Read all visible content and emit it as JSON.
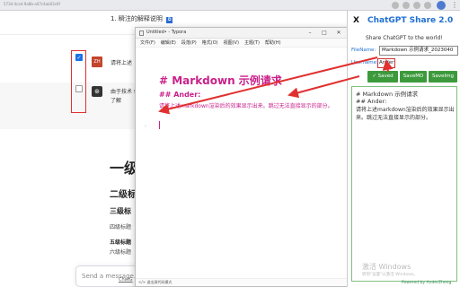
{
  "browser": {
    "url_text": "5734-4ca4-9a8b-a07c4ab03c6f"
  },
  "chat": {
    "numbered_item": "1. 瞬注的解释说明",
    "copy_icon": "copy-icon",
    "user_avatar": "ZH",
    "user_message": "请将上述",
    "gpt_avatar": "⊛",
    "gpt_message": "由于技术 便宜了解",
    "h1": "一级",
    "h2": "二级标",
    "h3": "三级标",
    "h4": "四级标题",
    "h5": "五级标题",
    "h6": "六级标题",
    "send_placeholder": "Send a message...",
    "footer_link": "ChatG"
  },
  "typora": {
    "title": "Untitled• - Typora",
    "menu": [
      "文件(F)",
      "编辑(E)",
      "段落(P)",
      "格式(O)",
      "视图(V)",
      "主题(T)",
      "帮助(H)"
    ],
    "heading1": "# Markdown 示例请求",
    "heading2": "## Ander:",
    "paragraph": "请将上述markdown渲染后的效果显示出来。跳过无法直接显示的部分。",
    "status": "</> 退出源代码模式",
    "colors": {
      "source_text": "#c9218a"
    }
  },
  "extension": {
    "close_label": "X",
    "title": "ChatGPT Share 2.0",
    "subtitle": "Share ChatGPT to the world!",
    "filename_label": "FileName:",
    "filename_value": "Markdown 示例请求_2023040",
    "username_label": "Username:",
    "username_value": "Ander",
    "buttons": {
      "saved": "✓ Saved",
      "savemd": "SaveMD",
      "saveimg": "SaveImg"
    },
    "preview_h1": "# Markdown 示例请求",
    "preview_h2": "## Ander:",
    "preview_paragraph": "请将上述markdown渲染后的效果显示出来。跳过无法直接显示的部分。",
    "activate_title": "激活 Windows",
    "activate_sub": "转到\"设置\"以激活 Windows。",
    "powered": "Powered by AnderZheng",
    "colors": {
      "title": "#1f6fd1",
      "button": "#3c9a3c"
    }
  },
  "annotation": {
    "color": "#e03030"
  }
}
